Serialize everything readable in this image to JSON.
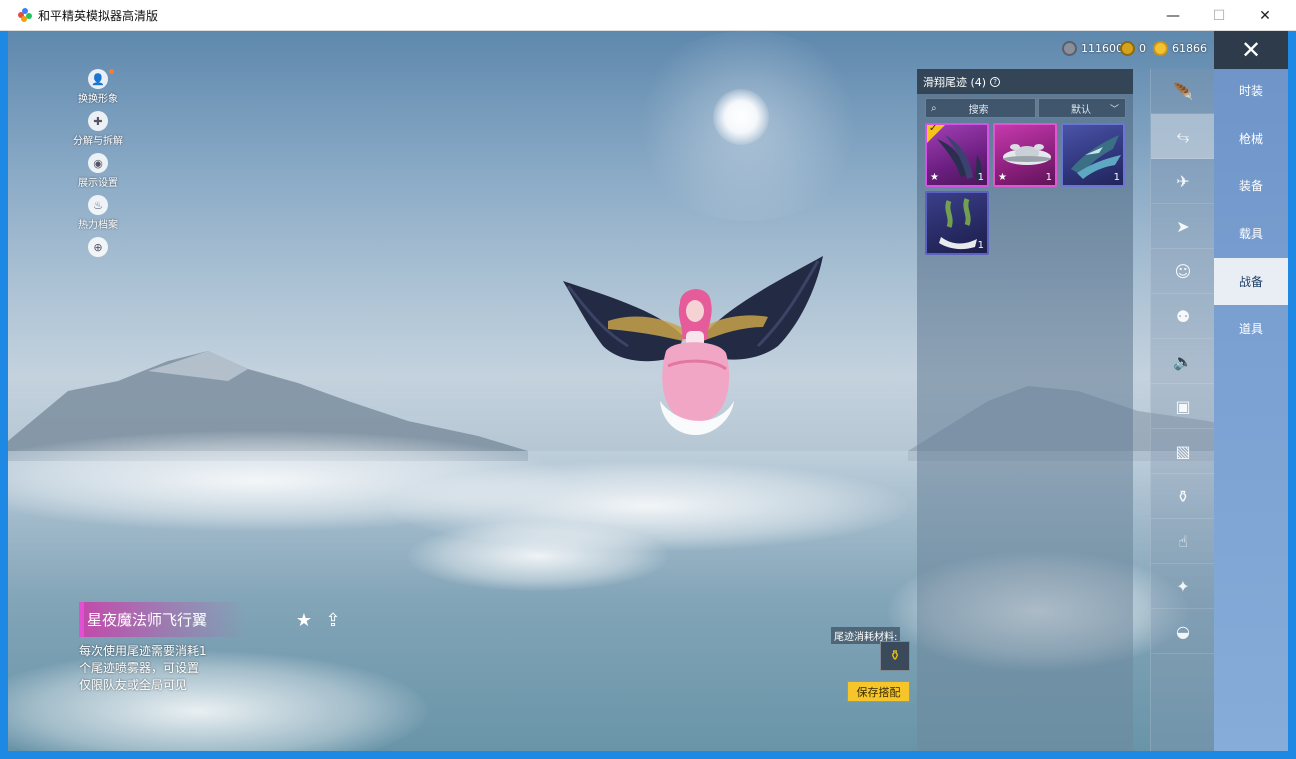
{
  "window": {
    "title": "和平精英模拟器高清版",
    "controls": {
      "minimize": "—",
      "maximize": "☐",
      "close": "✕"
    }
  },
  "left_menu": [
    {
      "label": "换换形象",
      "icon": "avatar-icon"
    },
    {
      "label": "分解与拆解",
      "icon": "puzzle-icon"
    },
    {
      "label": "展示设置",
      "icon": "eye-icon"
    },
    {
      "label": "热力档案",
      "icon": "flame-icon"
    },
    {
      "label": "",
      "icon": "plus-icon"
    }
  ],
  "currency": [
    {
      "value": "111600",
      "icon": "silver-coin-icon",
      "color": "#8a8f9a"
    },
    {
      "value": "0",
      "icon": "gold-medal-icon",
      "color": "#d4a21c"
    },
    {
      "value": "61866",
      "icon": "gold-coin-icon",
      "color": "#f2c230"
    }
  ],
  "panel": {
    "title": "滑翔尾迹 (4)",
    "help_icon": "?",
    "search_label": "搜索",
    "sort_label": "默认",
    "items": [
      {
        "qty": "1",
        "starred": true,
        "equipped": true,
        "color": "#8a2a9c",
        "icon": "raven-wings-icon"
      },
      {
        "qty": "1",
        "starred": true,
        "equipped": false,
        "color": "#b0309e",
        "icon": "flying-saucer-icon"
      },
      {
        "qty": "1",
        "starred": false,
        "equipped": false,
        "color": "#3a3f8f",
        "icon": "mech-wings-icon"
      },
      {
        "qty": "1",
        "starred": false,
        "equipped": false,
        "color": "#2c2f6e",
        "icon": "smoke-trail-icon"
      }
    ]
  },
  "category_icons": [
    "wing-icon",
    "glide-trail-icon",
    "drone-icon",
    "plane-icon",
    "emote-icon",
    "robot-icon",
    "speaker-icon",
    "chat-bubble-icon",
    "photo-icon",
    "spray-icon",
    "hand-icon",
    "wand-icon",
    "landing-icon"
  ],
  "categories": {
    "close": "✕",
    "items": [
      {
        "label": "时装",
        "active": false
      },
      {
        "label": "枪械",
        "active": false
      },
      {
        "label": "装备",
        "active": false
      },
      {
        "label": "载具",
        "active": false
      },
      {
        "label": "战备",
        "active": true
      },
      {
        "label": "道具",
        "active": false
      }
    ]
  },
  "selected_item": {
    "name": "星夜魔法师飞行翼",
    "desc_line1": "每次使用尾迹需要消耗1",
    "desc_line2": "个尾迹喷雾器，可设置",
    "desc_line3": "仅限队友或全局可见",
    "fav_icon": "★",
    "share_icon": "⇪"
  },
  "material": {
    "label": "尾迹消耗材料:",
    "slot_icon": "spray-can-icon",
    "save_label": "保存搭配"
  }
}
